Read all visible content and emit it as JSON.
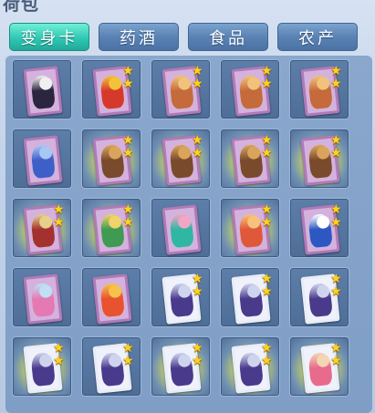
{
  "header": {
    "title": "荷包"
  },
  "tabs": [
    {
      "label": "变身卡",
      "active": true
    },
    {
      "label": "药酒",
      "active": false
    },
    {
      "label": "食品",
      "active": false
    },
    {
      "label": "农产",
      "active": false
    }
  ],
  "colors": {
    "tab_active": "#2fc7b3",
    "tab_inactive": "#5a82b3",
    "star": "#ffd21f",
    "card_purple": "#b07ab8",
    "card_white": "#e8ecf7"
  },
  "grid": {
    "rows": [
      [
        {
          "icon": "dark-warrior-card-icon",
          "stars": 0,
          "frame": "purple",
          "glow": false,
          "figure": "#2c2540",
          "accent": "#f0f0f0"
        },
        {
          "icon": "lion-dancer-card-icon",
          "stars": 2,
          "frame": "purple",
          "glow": false,
          "figure": "#d6392a",
          "accent": "#f4c23a"
        },
        {
          "icon": "monkey-king-card-icon",
          "stars": 2,
          "frame": "purple",
          "glow": false,
          "figure": "#c46a3b",
          "accent": "#f1c27a"
        },
        {
          "icon": "monkey-king-card-icon",
          "stars": 2,
          "frame": "purple",
          "glow": false,
          "figure": "#c46a3b",
          "accent": "#f1c27a"
        },
        {
          "icon": "monkey-king-card-icon",
          "stars": 2,
          "frame": "purple",
          "glow": false,
          "figure": "#c46a3b",
          "accent": "#f1c27a"
        }
      ],
      [
        {
          "icon": "blue-fox-card-icon",
          "stars": 0,
          "frame": "purple",
          "glow": false,
          "figure": "#3f5fc8",
          "accent": "#a8c8f4"
        },
        {
          "icon": "golden-demon-card-icon",
          "stars": 2,
          "frame": "purple",
          "glow": true,
          "figure": "#7a4a2c",
          "accent": "#d9a55a"
        },
        {
          "icon": "golden-demon-card-icon",
          "stars": 2,
          "frame": "purple",
          "glow": true,
          "figure": "#7a4a2c",
          "accent": "#d9a55a"
        },
        {
          "icon": "golden-demon-card-icon",
          "stars": 2,
          "frame": "purple",
          "glow": true,
          "figure": "#7a4a2c",
          "accent": "#d9a55a"
        },
        {
          "icon": "golden-demon-card-icon",
          "stars": 2,
          "frame": "purple",
          "glow": true,
          "figure": "#7a4a2c",
          "accent": "#d9a55a"
        }
      ],
      [
        {
          "icon": "armored-general-card-icon",
          "stars": 2,
          "frame": "purple",
          "glow": true,
          "figure": "#a3322e",
          "accent": "#e6d08a"
        },
        {
          "icon": "jade-warrior-card-icon",
          "stars": 2,
          "frame": "purple",
          "glow": true,
          "figure": "#3f9a52",
          "accent": "#f0d36a"
        },
        {
          "icon": "fairy-dancer-card-icon",
          "stars": 0,
          "frame": "purple",
          "glow": false,
          "figure": "#2fb7a3",
          "accent": "#f0a6c4"
        },
        {
          "icon": "fire-maiden-card-icon",
          "stars": 2,
          "frame": "purple",
          "glow": true,
          "figure": "#e0583a",
          "accent": "#f7c27a"
        },
        {
          "icon": "blue-beast-card-icon",
          "stars": 2,
          "frame": "purple",
          "glow": false,
          "figure": "#2d58c2",
          "accent": "#ffffff"
        }
      ],
      [
        {
          "icon": "pink-fairy-card-icon",
          "stars": 0,
          "frame": "purple",
          "glow": false,
          "figure": "#e47ab4",
          "accent": "#bfe0f4"
        },
        {
          "icon": "phoenix-card-icon",
          "stars": 0,
          "frame": "purple",
          "glow": false,
          "figure": "#e8522e",
          "accent": "#f6c24a"
        },
        {
          "icon": "purple-knight-card-icon",
          "stars": 2,
          "frame": "white",
          "glow": false,
          "figure": "#4a3a8c",
          "accent": "#cfd4ee"
        },
        {
          "icon": "purple-knight-card-icon",
          "stars": 2,
          "frame": "white",
          "glow": false,
          "figure": "#4a3a8c",
          "accent": "#cfd4ee"
        },
        {
          "icon": "purple-knight-card-icon",
          "stars": 2,
          "frame": "white",
          "glow": false,
          "figure": "#4a3a8c",
          "accent": "#cfd4ee"
        }
      ],
      [
        {
          "icon": "purple-knight-card-icon",
          "stars": 2,
          "frame": "white",
          "glow": true,
          "figure": "#4a3a8c",
          "accent": "#cfd4ee"
        },
        {
          "icon": "purple-knight-card-icon",
          "stars": 2,
          "frame": "white",
          "glow": false,
          "figure": "#4a3a8c",
          "accent": "#cfd4ee"
        },
        {
          "icon": "purple-knight-card-icon",
          "stars": 2,
          "frame": "white",
          "glow": true,
          "figure": "#4a3a8c",
          "accent": "#cfd4ee"
        },
        {
          "icon": "purple-knight-card-icon",
          "stars": 2,
          "frame": "white",
          "glow": true,
          "figure": "#4a3a8c",
          "accent": "#cfd4ee"
        },
        {
          "icon": "pink-girl-card-icon",
          "stars": 2,
          "frame": "white",
          "glow": true,
          "figure": "#e86a8c",
          "accent": "#f3d6b4"
        }
      ]
    ]
  }
}
